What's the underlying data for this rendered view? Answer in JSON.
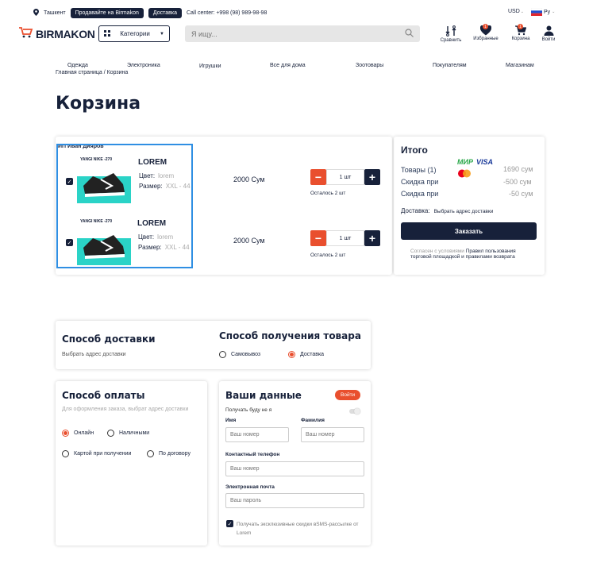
{
  "topbar": {
    "city": "Ташкент",
    "sell_label": "Продавайте на Birmakon",
    "delivery_label": "Доставка",
    "call_center": "Call center: +998 (98) 989-98-98",
    "currency": "USD",
    "language": "Ру"
  },
  "header": {
    "logo": "BIRMAKON",
    "categories_label": "Категории",
    "search_placeholder": "Я ищу...",
    "icons": [
      {
        "label": "Сравнить",
        "icon": "compare-icon"
      },
      {
        "label": "Избранные",
        "icon": "heart-icon",
        "badge": "1"
      },
      {
        "label": "Корзина",
        "icon": "cart-icon",
        "badge": "1"
      },
      {
        "label": "Войти",
        "icon": "user-icon"
      }
    ]
  },
  "nav": [
    "Одежда",
    "Электроника",
    "Игрушки",
    "Все для дома",
    "Зоотовары",
    "Покупателям",
    "Магазинам"
  ],
  "breadcrumb": {
    "home": "Главная страница",
    "sep": "/",
    "current": "Корзина"
  },
  "page_title": "Корзина",
  "cart": {
    "seller": "ИП Иван Дияров",
    "items": [
      {
        "img_title": "YANGI NIKE -270",
        "name": "LOREM",
        "color_label": "Цвет:",
        "color": "lorem",
        "size_label": "Размер:",
        "size": "XXL - 44",
        "price": "2000 Сум",
        "qty": "1 шт",
        "left": "Осталось 2 шт"
      },
      {
        "img_title": "YANGI NIKE -270",
        "name": "LOREM",
        "color_label": "Цвет:",
        "color": "lorem",
        "size_label": "Размер:",
        "size": "XXL - 44",
        "price": "2000 Сум",
        "qty": "1 шт",
        "left": "Осталось 2 шт"
      }
    ]
  },
  "summary": {
    "title": "Итого",
    "payment_logos": [
      "МИР",
      "VISA",
      "MasterCard"
    ],
    "rows": [
      {
        "label": "Товары (1)",
        "value": "1690 сум"
      },
      {
        "label": "Скидка при",
        "value": "-500 сум"
      },
      {
        "label": "Скидка при",
        "value": "-50 сум"
      }
    ],
    "delivery_label": "Доставка:",
    "delivery_value": "Выбрать адрес доставки",
    "order_button": "Заказать",
    "terms_prefix": "Согласен с условиями",
    "terms_link": "Правил пользования торговой площадкой и правилами возврата"
  },
  "delivery_method": {
    "title": "Способ доставки",
    "subtitle": "Выбрать адрес доставки"
  },
  "receive_method": {
    "title": "Способ получения товара",
    "options": [
      {
        "label": "Самовывоз",
        "selected": false
      },
      {
        "label": "Доставка",
        "selected": true
      }
    ]
  },
  "payment": {
    "title": "Способ оплаты",
    "subtitle": "Для оформления заказа, выбрат адрес доставки",
    "options": [
      {
        "label": "Онлайн",
        "selected": true
      },
      {
        "label": "Наличными",
        "selected": false
      },
      {
        "label": "Картой при получении",
        "selected": false
      },
      {
        "label": "По договору",
        "selected": false
      }
    ]
  },
  "your_data": {
    "title": "Ваши данные",
    "login_button": "Войти",
    "receive_label": "Получать буду не я",
    "first_name_label": "Имя",
    "first_name_placeholder": "Ваш номер",
    "last_name_label": "Фамилия",
    "last_name_placeholder": "Ваш номер",
    "phone_label": "Контактный телефон",
    "phone_placeholder": "Ваш номер",
    "email_label": "Электронная почта",
    "email_placeholder": "Ваш пароль",
    "newsletter": "Получать эксклюзивные скидки вSMS-рассылке от Lorem"
  },
  "colors": {
    "primary": "#17213a",
    "accent": "#e94f2e",
    "selection": "#2f8fe3",
    "product_bg": "#2ad3c7"
  }
}
